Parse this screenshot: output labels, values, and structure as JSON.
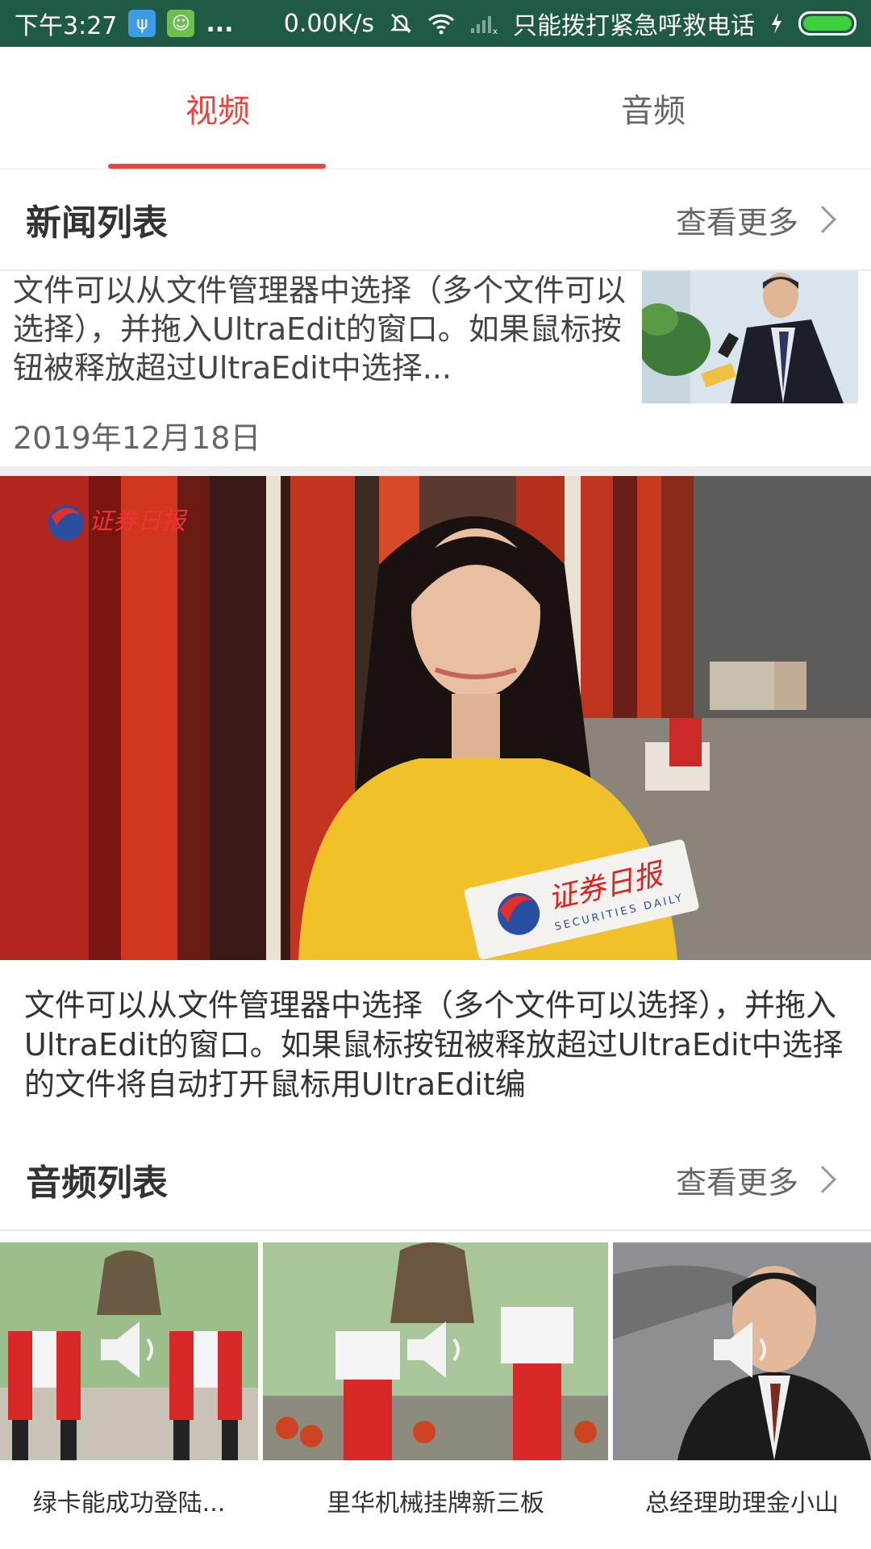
{
  "status_bar": {
    "time": "下午3:27",
    "dots": "...",
    "speed": "0.00K/s",
    "carrier": "只能拨打紧急呼救电话",
    "icons": [
      "usb-icon",
      "android-icon",
      "mute-icon",
      "wifi-icon",
      "signal-icon",
      "charging-icon",
      "battery-icon"
    ]
  },
  "tabs": [
    {
      "label": "视频",
      "active": true
    },
    {
      "label": "音频",
      "active": false
    }
  ],
  "news_section": {
    "title": "新闻列表",
    "more": "查看更多"
  },
  "news_item": {
    "text": "文件可以从文件管理器中选择（多个文件可以选择），并拖入UltraEdit的窗口。如果鼠标按钮被释放超过UltraEdit中选择...",
    "date": "2019年12月18日"
  },
  "video": {
    "logo_text": "证券日报",
    "mic_text": "证券日报",
    "mic_sub": "SECURITIES DAILY",
    "description": "文件可以从文件管理器中选择（多个文件可以选择），并拖入UltraEdit的窗口。如果鼠标按钮被释放超过UltraEdit中选择的文件将自动打开鼠标用UltraEdit编"
  },
  "audio_section": {
    "title": "音频列表",
    "more": "查看更多"
  },
  "audio_items": [
    {
      "title": "绿卡能成功登陆..."
    },
    {
      "title": "里华机械挂牌新三板"
    },
    {
      "title": "总经理助理金小山"
    }
  ],
  "colors": {
    "accent": "#e8453c",
    "status_bar": "#1f5b44"
  }
}
